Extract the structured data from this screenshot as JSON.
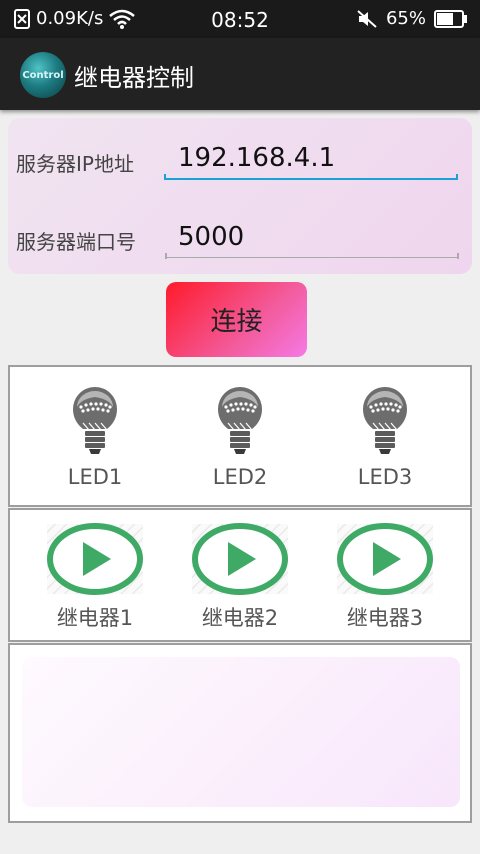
{
  "status_bar": {
    "speed": "0.09K/s",
    "time": "08:52",
    "battery": "65%"
  },
  "app_bar": {
    "logo_text": "Control",
    "title": "继电器控制"
  },
  "server": {
    "ip_label": "服务器IP地址",
    "ip_value": "192.168.4.1",
    "port_label": "服务器端口号",
    "port_value": "5000"
  },
  "connect_button": "连接",
  "leds": [
    {
      "label": "LED1"
    },
    {
      "label": "LED2"
    },
    {
      "label": "LED3"
    }
  ],
  "relays": [
    {
      "label": "继电器1"
    },
    {
      "label": "继电器2"
    },
    {
      "label": "继电器3"
    }
  ],
  "colors": {
    "accent_blue": "#1aa2d6",
    "play_green": "#3faa66",
    "connect_start": "#ff1a2a",
    "connect_end": "#f57ae6"
  }
}
